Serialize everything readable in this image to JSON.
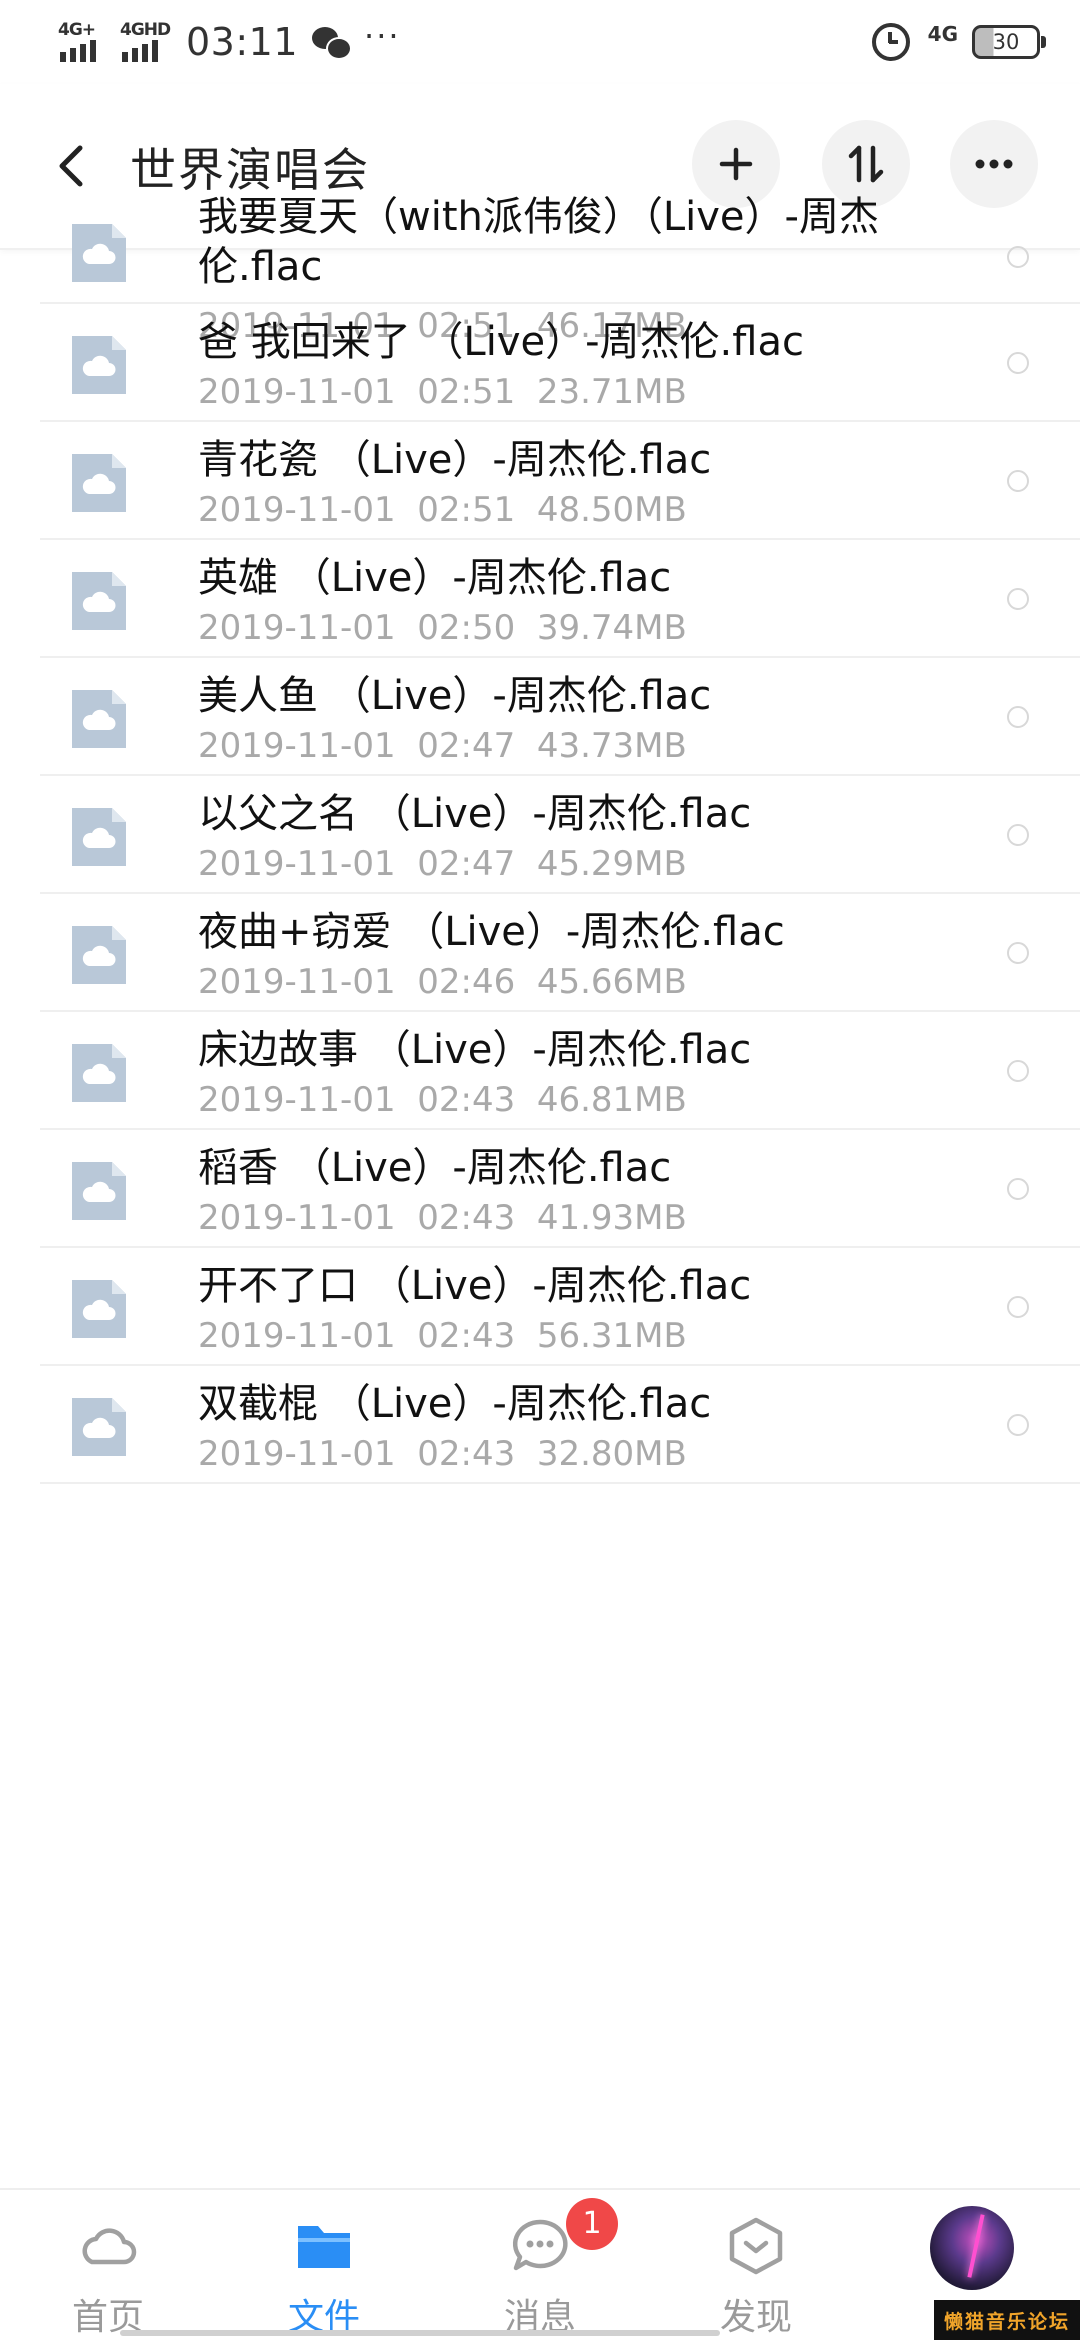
{
  "status_bar": {
    "signal1_label": "4G+",
    "signal2_label": "4GHD",
    "time": "03:11",
    "more": "···",
    "network_label": "4G",
    "battery": "30"
  },
  "header": {
    "title": "世界演唱会",
    "back_icon": "chevron-left-icon",
    "add_icon": "plus-icon",
    "sort_icon": "sort-icon",
    "more_icon": "more-icon"
  },
  "files": [
    {
      "name": "我要夏天（with派伟俊）（Live）-周杰伦.flac",
      "date": "2019-11-01",
      "time": "02:51",
      "size": "46.17MB"
    },
    {
      "name": "爸 我回来了 （Live）-周杰伦.flac",
      "date": "2019-11-01",
      "time": "02:51",
      "size": "23.71MB"
    },
    {
      "name": "青花瓷 （Live）-周杰伦.flac",
      "date": "2019-11-01",
      "time": "02:51",
      "size": "48.50MB"
    },
    {
      "name": "英雄 （Live）-周杰伦.flac",
      "date": "2019-11-01",
      "time": "02:50",
      "size": "39.74MB"
    },
    {
      "name": "美人鱼 （Live）-周杰伦.flac",
      "date": "2019-11-01",
      "time": "02:47",
      "size": "43.73MB"
    },
    {
      "name": "以父之名 （Live）-周杰伦.flac",
      "date": "2019-11-01",
      "time": "02:47",
      "size": "45.29MB"
    },
    {
      "name": "夜曲+窃爱 （Live）-周杰伦.flac",
      "date": "2019-11-01",
      "time": "02:46",
      "size": "45.66MB"
    },
    {
      "name": "床边故事 （Live）-周杰伦.flac",
      "date": "2019-11-01",
      "time": "02:43",
      "size": "46.81MB"
    },
    {
      "name": "稻香 （Live）-周杰伦.flac",
      "date": "2019-11-01",
      "time": "02:43",
      "size": "41.93MB"
    },
    {
      "name": "开不了口 （Live）-周杰伦.flac",
      "date": "2019-11-01",
      "time": "02:43",
      "size": "56.31MB"
    },
    {
      "name": "双截棍 （Live）-周杰伦.flac",
      "date": "2019-11-01",
      "time": "02:43",
      "size": "32.80MB"
    }
  ],
  "bottom_nav": {
    "items": [
      {
        "label": "首页",
        "icon": "cloud-icon"
      },
      {
        "label": "文件",
        "icon": "folder-icon"
      },
      {
        "label": "消息",
        "icon": "chat-icon"
      },
      {
        "label": "发现",
        "icon": "discover-icon"
      }
    ],
    "active_index": 1,
    "message_badge": "1"
  },
  "watermark": "懒猫音乐论坛",
  "colors": {
    "accent": "#2a8ef5",
    "badge": "#f04848",
    "meta_text": "#a9a9a9",
    "file_icon": "#b9c8d8"
  }
}
